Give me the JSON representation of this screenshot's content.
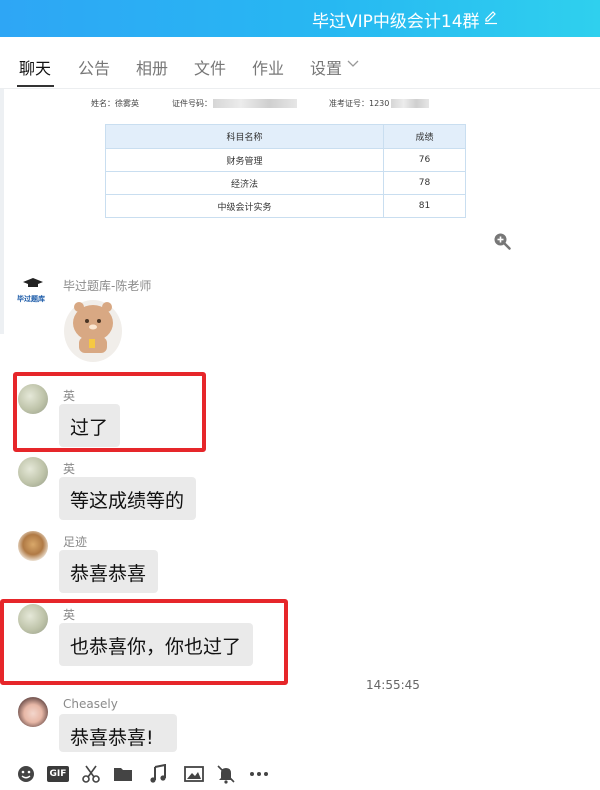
{
  "window": {
    "title": "毕过VIP中级会计14群"
  },
  "tabs": [
    {
      "label": "聊天",
      "active": true
    },
    {
      "label": "公告"
    },
    {
      "label": "相册"
    },
    {
      "label": "文件"
    },
    {
      "label": "作业"
    },
    {
      "label": "设置"
    }
  ],
  "score_image": {
    "name_label": "姓名：",
    "name_value": "徐雾英",
    "id_label": "证件号码：",
    "exam_label": "准考证号：",
    "exam_value": "1230",
    "headers": [
      "科目名称",
      "成绩"
    ],
    "rows": [
      {
        "subject": "财务管理",
        "score": "76"
      },
      {
        "subject": "经济法",
        "score": "78"
      },
      {
        "subject": "中级会计实务",
        "score": "81"
      }
    ]
  },
  "messages": [
    {
      "sender": "毕过题库-陈老师",
      "avatar_text": "毕过题库",
      "type": "sticker"
    },
    {
      "sender": "英",
      "text": "过了",
      "highlighted": true
    },
    {
      "sender": "英",
      "text": "等这成绩等的"
    },
    {
      "sender": "足迹",
      "text": "恭喜恭喜"
    },
    {
      "sender": "英",
      "text": "也恭喜你，你也过了",
      "highlighted": true
    },
    {
      "sender": "Cheasely",
      "text": "恭喜恭喜!"
    }
  ],
  "timestamp": "14:55:45",
  "toolbar": {
    "gif_label": "GIF",
    "icons": [
      "emoji-icon",
      "gif-icon",
      "scissors-icon",
      "folder-icon",
      "music-icon",
      "image-icon",
      "mute-bell-icon",
      "more-icon"
    ]
  },
  "colors": {
    "accent": "#2ea6f5",
    "highlight": "#e6262a",
    "bubble": "#eaeaea"
  }
}
